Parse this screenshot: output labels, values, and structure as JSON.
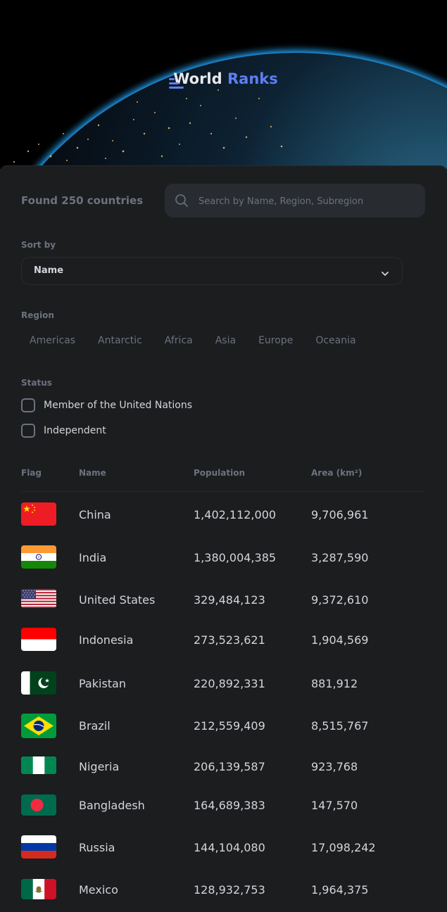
{
  "header": {
    "logo_text_1": "World",
    "logo_text_2": "Ranks",
    "colors": {
      "accent": "#5d7ef2",
      "background": "#1b1d1f",
      "muted": "#6c727f",
      "text": "#d2d5da"
    }
  },
  "summary": {
    "found_text": "Found 250 countries"
  },
  "search": {
    "placeholder": "Search by Name, Region, Subregion",
    "value": ""
  },
  "sort": {
    "label": "Sort by",
    "selected": "Name"
  },
  "region": {
    "label": "Region",
    "items": [
      "Americas",
      "Antarctic",
      "Africa",
      "Asia",
      "Europe",
      "Oceania"
    ]
  },
  "status": {
    "label": "Status",
    "options": [
      {
        "label": "Member of the United Nations",
        "checked": false
      },
      {
        "label": "Independent",
        "checked": false
      }
    ]
  },
  "table": {
    "headers": {
      "flag": "Flag",
      "name": "Name",
      "population": "Population",
      "area": "Area (km²)"
    },
    "rows": [
      {
        "flag": "china-flag",
        "name": "China",
        "population": "1,402,112,000",
        "area": "9,706,961"
      },
      {
        "flag": "india-flag",
        "name": "India",
        "population": "1,380,004,385",
        "area": "3,287,590"
      },
      {
        "flag": "united-states-flag",
        "name": "United States",
        "population": "329,484,123",
        "area": "9,372,610"
      },
      {
        "flag": "indonesia-flag",
        "name": "Indonesia",
        "population": "273,523,621",
        "area": "1,904,569"
      },
      {
        "flag": "pakistan-flag",
        "name": "Pakistan",
        "population": "220,892,331",
        "area": "881,912"
      },
      {
        "flag": "brazil-flag",
        "name": "Brazil",
        "population": "212,559,409",
        "area": "8,515,767"
      },
      {
        "flag": "nigeria-flag",
        "name": "Nigeria",
        "population": "206,139,587",
        "area": "923,768"
      },
      {
        "flag": "bangladesh-flag",
        "name": "Bangladesh",
        "population": "164,689,383",
        "area": "147,570"
      },
      {
        "flag": "russia-flag",
        "name": "Russia",
        "population": "144,104,080",
        "area": "17,098,242"
      },
      {
        "flag": "mexico-flag",
        "name": "Mexico",
        "population": "128,932,753",
        "area": "1,964,375"
      }
    ]
  }
}
